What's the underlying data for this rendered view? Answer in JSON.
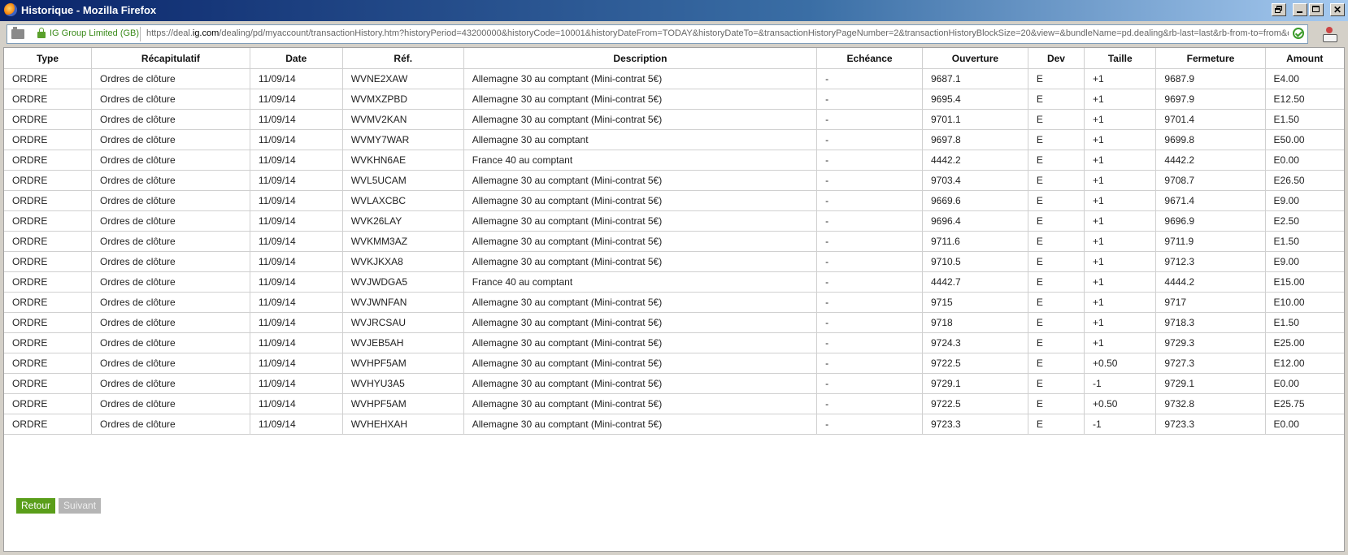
{
  "window": {
    "title": "Historique - Mozilla Firefox"
  },
  "addressbar": {
    "identity": "IG Group Limited (GB)",
    "url_prefix": "https://deal.",
    "url_domain": "ig.com",
    "url_rest": "/dealing/pd/myaccount/transactionHistory.htm?historyPeriod=43200000&historyCode=10001&historyDateFrom=TODAY&historyDateTo=&transactionHistoryPageNumber=2&transactionHistoryBlockSize=20&view=&bundleName=pd.dealing&rb-last=last&rb-from-to=from&da"
  },
  "table": {
    "columns": [
      "Type",
      "Récapitulatif",
      "Date",
      "Réf.",
      "Description",
      "Echéance",
      "Ouverture",
      "Dev",
      "Taille",
      "Fermeture",
      "Amount"
    ],
    "rows": [
      [
        "ORDRE",
        "Ordres de clôture",
        "11/09/14",
        "WVNE2XAW",
        "Allemagne 30 au comptant (Mini-contrat 5€)",
        "-",
        "9687.1",
        "E",
        "+1",
        "9687.9",
        "E4.00"
      ],
      [
        "ORDRE",
        "Ordres de clôture",
        "11/09/14",
        "WVMXZPBD",
        "Allemagne 30 au comptant (Mini-contrat 5€)",
        "-",
        "9695.4",
        "E",
        "+1",
        "9697.9",
        "E12.50"
      ],
      [
        "ORDRE",
        "Ordres de clôture",
        "11/09/14",
        "WVMV2KAN",
        "Allemagne 30 au comptant (Mini-contrat 5€)",
        "-",
        "9701.1",
        "E",
        "+1",
        "9701.4",
        "E1.50"
      ],
      [
        "ORDRE",
        "Ordres de clôture",
        "11/09/14",
        "WVMY7WAR",
        "Allemagne 30 au comptant",
        "-",
        "9697.8",
        "E",
        "+1",
        "9699.8",
        "E50.00"
      ],
      [
        "ORDRE",
        "Ordres de clôture",
        "11/09/14",
        "WVKHN6AE",
        "France 40 au comptant",
        "-",
        "4442.2",
        "E",
        "+1",
        "4442.2",
        "E0.00"
      ],
      [
        "ORDRE",
        "Ordres de clôture",
        "11/09/14",
        "WVL5UCAM",
        "Allemagne 30 au comptant (Mini-contrat 5€)",
        "-",
        "9703.4",
        "E",
        "+1",
        "9708.7",
        "E26.50"
      ],
      [
        "ORDRE",
        "Ordres de clôture",
        "11/09/14",
        "WVLAXCBC",
        "Allemagne 30 au comptant (Mini-contrat 5€)",
        "-",
        "9669.6",
        "E",
        "+1",
        "9671.4",
        "E9.00"
      ],
      [
        "ORDRE",
        "Ordres de clôture",
        "11/09/14",
        "WVK26LAY",
        "Allemagne 30 au comptant (Mini-contrat 5€)",
        "-",
        "9696.4",
        "E",
        "+1",
        "9696.9",
        "E2.50"
      ],
      [
        "ORDRE",
        "Ordres de clôture",
        "11/09/14",
        "WVKMM3AZ",
        "Allemagne 30 au comptant (Mini-contrat 5€)",
        "-",
        "9711.6",
        "E",
        "+1",
        "9711.9",
        "E1.50"
      ],
      [
        "ORDRE",
        "Ordres de clôture",
        "11/09/14",
        "WVKJKXA8",
        "Allemagne 30 au comptant (Mini-contrat 5€)",
        "-",
        "9710.5",
        "E",
        "+1",
        "9712.3",
        "E9.00"
      ],
      [
        "ORDRE",
        "Ordres de clôture",
        "11/09/14",
        "WVJWDGA5",
        "France 40 au comptant",
        "-",
        "4442.7",
        "E",
        "+1",
        "4444.2",
        "E15.00"
      ],
      [
        "ORDRE",
        "Ordres de clôture",
        "11/09/14",
        "WVJWNFAN",
        "Allemagne 30 au comptant (Mini-contrat 5€)",
        "-",
        "9715",
        "E",
        "+1",
        "9717",
        "E10.00"
      ],
      [
        "ORDRE",
        "Ordres de clôture",
        "11/09/14",
        "WVJRCSAU",
        "Allemagne 30 au comptant (Mini-contrat 5€)",
        "-",
        "9718",
        "E",
        "+1",
        "9718.3",
        "E1.50"
      ],
      [
        "ORDRE",
        "Ordres de clôture",
        "11/09/14",
        "WVJEB5AH",
        "Allemagne 30 au comptant (Mini-contrat 5€)",
        "-",
        "9724.3",
        "E",
        "+1",
        "9729.3",
        "E25.00"
      ],
      [
        "ORDRE",
        "Ordres de clôture",
        "11/09/14",
        "WVHPF5AM",
        "Allemagne 30 au comptant (Mini-contrat 5€)",
        "-",
        "9722.5",
        "E",
        "+0.50",
        "9727.3",
        "E12.00"
      ],
      [
        "ORDRE",
        "Ordres de clôture",
        "11/09/14",
        "WVHYU3A5",
        "Allemagne 30 au comptant (Mini-contrat 5€)",
        "-",
        "9729.1",
        "E",
        "-1",
        "9729.1",
        "E0.00"
      ],
      [
        "ORDRE",
        "Ordres de clôture",
        "11/09/14",
        "WVHPF5AM",
        "Allemagne 30 au comptant (Mini-contrat 5€)",
        "-",
        "9722.5",
        "E",
        "+0.50",
        "9732.8",
        "E25.75"
      ],
      [
        "ORDRE",
        "Ordres de clôture",
        "11/09/14",
        "WVHEHXAH",
        "Allemagne 30 au comptant (Mini-contrat 5€)",
        "-",
        "9723.3",
        "E",
        "-1",
        "9723.3",
        "E0.00"
      ]
    ]
  },
  "pager": {
    "back_label": "Retour",
    "next_label": "Suivant"
  }
}
